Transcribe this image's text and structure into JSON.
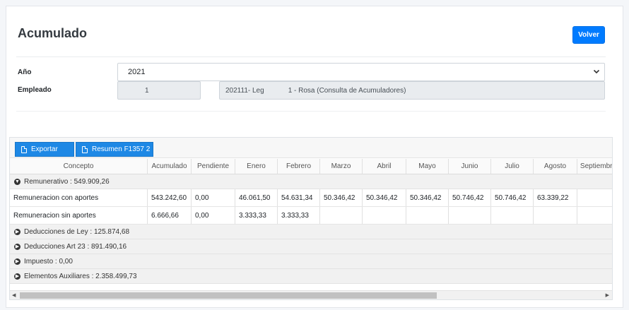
{
  "page": {
    "title": "Acumulado",
    "back_label": "Volver"
  },
  "form": {
    "year_label": "Año",
    "year_value": "2021",
    "employee_label": "Empleado",
    "employee_id": "1",
    "employee_code": "202111- Leg",
    "employee_name": "1 - Rosa (Consulta de Acumuladores)"
  },
  "toolbar": {
    "export_label": "Exportar",
    "summary_label": "Resumen F1357 2"
  },
  "table": {
    "headers": [
      "Concepto",
      "Acumulado",
      "Pendiente",
      "Enero",
      "Febrero",
      "Marzo",
      "Abril",
      "Mayo",
      "Junio",
      "Julio",
      "Agosto",
      "Septiembre"
    ],
    "groups": [
      {
        "label": "Remunerativo : 549.909,26",
        "expanded": true,
        "rows": [
          [
            "Remuneracion con aportes",
            "543.242,60",
            "0,00",
            "46.061,50",
            "54.631,34",
            "50.346,42",
            "50.346,42",
            "50.346,42",
            "50.746,42",
            "50.746,42",
            "63.339,22",
            ""
          ],
          [
            "Remuneracion sin aportes",
            "6.666,66",
            "0,00",
            "3.333,33",
            "3.333,33",
            "",
            "",
            "",
            "",
            "",
            "",
            ""
          ]
        ]
      },
      {
        "label": "Deducciones de Ley : 125.874,68",
        "expanded": false,
        "rows": []
      },
      {
        "label": "Deducciones Art 23 : 891.490,16",
        "expanded": false,
        "rows": []
      },
      {
        "label": "Impuesto : 0,00",
        "expanded": false,
        "rows": []
      },
      {
        "label": "Elementos Auxiliares : 2.358.499,73",
        "expanded": false,
        "rows": []
      }
    ]
  },
  "icons": {
    "expanded": "chevron-down-circle-icon",
    "collapsed": "chevron-right-circle-icon",
    "export": "document-icon",
    "summary": "document-icon"
  },
  "colors": {
    "primary": "#007bff",
    "toolbar_button": "#1e88e5",
    "group_bg": "#f1f1f1"
  }
}
